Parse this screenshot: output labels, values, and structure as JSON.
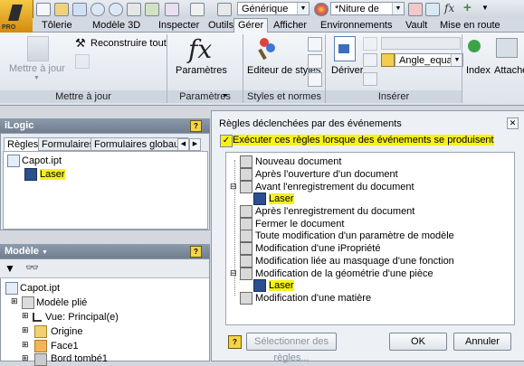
{
  "quick_access": {
    "material_combo": "Générique",
    "finish_combo": "*Niture de"
  },
  "app_button": {
    "label": "PRO"
  },
  "tabs": [
    "Tôlerie",
    "Modèle 3D",
    "Inspecter",
    "Outils",
    "Gérer",
    "Afficher",
    "Environnements",
    "Vault",
    "Mise en route"
  ],
  "ribbon": {
    "update_group": {
      "mettre_a_jour": "Mettre à jour",
      "reconstruire": "Reconstruire tout",
      "label": "Mettre à jour"
    },
    "params_group": {
      "parametres": "Paramètres",
      "label": "Paramètres"
    },
    "styles_group": {
      "editeur": "Editeur de styles",
      "label": "Styles et normes"
    },
    "insert_group": {
      "deriver": "Dériver",
      "angle_combo": "Angle_equal",
      "label": "Insérer"
    },
    "index_label": "Index",
    "attach_label": "Attache"
  },
  "ilogic_panel": {
    "title": "iLogic",
    "subtabs": [
      "Règles",
      "Formulaires",
      "Formulaires globaux"
    ],
    "tree": {
      "file": "Capot.ipt",
      "rule": "Laser"
    }
  },
  "model_panel": {
    "title": "Modèle",
    "tree": [
      "Capot.ipt",
      "Modèle plié",
      "Vue: Principal(e)",
      "Origine",
      "Face1",
      "Bord tombé1"
    ]
  },
  "dialog": {
    "title": "Règles déclenchées par des événements",
    "checkbox_label": "Exécuter ces règles lorsque des événements se produisent",
    "events": [
      {
        "label": "Nouveau document",
        "rule": ""
      },
      {
        "label": "Après l'ouverture d'un document",
        "rule": ""
      },
      {
        "label": "Avant l'enregistrement du document",
        "rule": "Laser"
      },
      {
        "label": "Après l'enregistrement du document",
        "rule": ""
      },
      {
        "label": "Fermer le document",
        "rule": ""
      },
      {
        "label": "Toute modification d'un paramètre de modèle",
        "rule": ""
      },
      {
        "label": "Modification d'une iPropriété",
        "rule": ""
      },
      {
        "label": "Modification liée au masquage d'une fonction",
        "rule": ""
      },
      {
        "label": "Modification de la géométrie d'une pièce",
        "rule": "Laser"
      },
      {
        "label": "Modification d'une matière",
        "rule": ""
      }
    ],
    "select_button": "Sélectionner des règles...",
    "ok": "OK",
    "cancel": "Annuler"
  }
}
